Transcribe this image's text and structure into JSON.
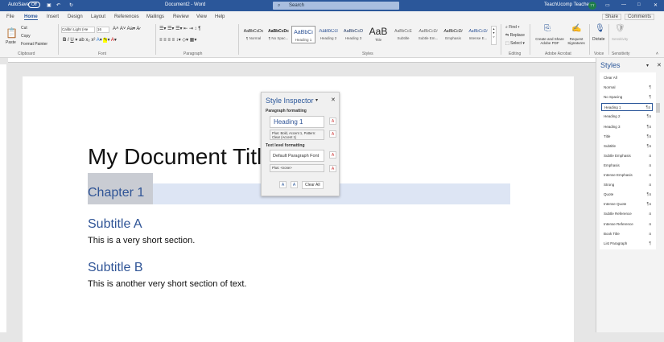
{
  "titlebar": {
    "autosave": "AutoSave",
    "autosave_state": "Off",
    "doc_title": "Document2 - Word",
    "search_placeholder": "Search",
    "user": "TeachUcomp Teacher",
    "avatar": "TT"
  },
  "tabs": [
    "File",
    "Home",
    "Insert",
    "Design",
    "Layout",
    "References",
    "Mailings",
    "Review",
    "View",
    "Help"
  ],
  "active_tab": "Home",
  "share": "Share",
  "comments": "Comments",
  "ribbon": {
    "clipboard": {
      "label": "Clipboard",
      "paste": "Paste",
      "cut": "Cut",
      "copy": "Copy",
      "format_painter": "Format Painter"
    },
    "font": {
      "label": "Font",
      "font_name": "Calibri Light (He",
      "font_size": "16"
    },
    "paragraph": {
      "label": "Paragraph"
    },
    "styles": {
      "label": "Styles",
      "items": [
        {
          "preview": "AaBbCcDc",
          "name": "¶ Normal"
        },
        {
          "preview": "AaBbCcDc",
          "name": "¶ No Spac..."
        },
        {
          "preview": "AaBbCi",
          "name": "Heading 1"
        },
        {
          "preview": "AaBbCcl",
          "name": "Heading 2"
        },
        {
          "preview": "AaBbCcD",
          "name": "Heading 3"
        },
        {
          "preview": "AaB",
          "name": "Title"
        },
        {
          "preview": "AaBbCcE",
          "name": "Subtitle"
        },
        {
          "preview": "AaBbCcDi",
          "name": "Subtle Em..."
        },
        {
          "preview": "AaBbCcDi",
          "name": "Emphasis"
        },
        {
          "preview": "AaBbCcDi",
          "name": "Intense E..."
        }
      ]
    },
    "editing": {
      "label": "Editing",
      "find": "Find",
      "replace": "Replace",
      "select": "Select"
    },
    "acrobat": {
      "label": "Adobe Acrobat",
      "create": "Create and Share Adobe PDF",
      "request": "Request Signatures"
    },
    "voice": {
      "label": "Voice",
      "dictate": "Dictate"
    },
    "sensitivity": {
      "label": "Sensitivity",
      "button": "Sensitivity"
    }
  },
  "document": {
    "title": "My Document Title",
    "chapter": "Chapter 1",
    "subtitle_a": "Subtitle A",
    "body_a": "This is a very short section.",
    "subtitle_b": "Subtitle B",
    "body_b": "This is another very short section of text.",
    "heading_color": "#2f5496"
  },
  "inspector": {
    "title": "Style Inspector",
    "para_label": "Paragraph formatting",
    "para_style": "Heading 1",
    "para_plus": "Plus: Bold, Accent 1, Pattern: Clear (Accent 1)",
    "text_label": "Text level formatting",
    "text_style": "Default Paragraph Font",
    "text_plus": "Plus: <none>",
    "clear_all": "Clear All"
  },
  "styles_pane": {
    "title": "Styles",
    "selected": "Heading 1",
    "items": [
      {
        "name": "Clear All",
        "mark": ""
      },
      {
        "name": "Normal",
        "mark": "¶"
      },
      {
        "name": "No Spacing",
        "mark": "¶"
      },
      {
        "name": "Heading 1",
        "mark": "¶a"
      },
      {
        "name": "Heading 2",
        "mark": "¶a"
      },
      {
        "name": "Heading 3",
        "mark": "¶a"
      },
      {
        "name": "Title",
        "mark": "¶a"
      },
      {
        "name": "Subtitle",
        "mark": "¶a"
      },
      {
        "name": "Subtle Emphasis",
        "mark": "a"
      },
      {
        "name": "Emphasis",
        "mark": "a"
      },
      {
        "name": "Intense Emphasis",
        "mark": "a"
      },
      {
        "name": "Strong",
        "mark": "a"
      },
      {
        "name": "Quote",
        "mark": "¶a"
      },
      {
        "name": "Intense Quote",
        "mark": "¶a"
      },
      {
        "name": "Subtle Reference",
        "mark": "a"
      },
      {
        "name": "Intense Reference",
        "mark": "a"
      },
      {
        "name": "Book Title",
        "mark": "a"
      },
      {
        "name": "List Paragraph",
        "mark": "¶"
      }
    ]
  },
  "colors": {
    "brand": "#2b579a"
  }
}
